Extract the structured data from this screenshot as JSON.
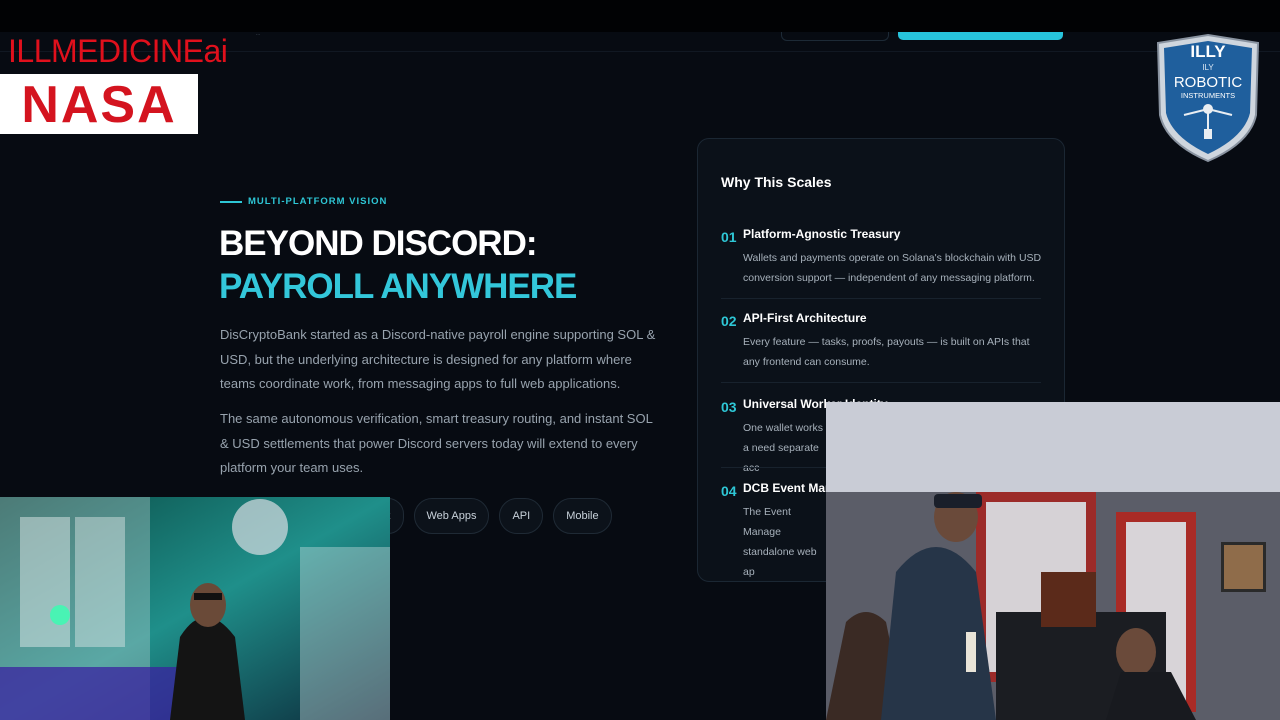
{
  "nav": {
    "tiny_text": "..."
  },
  "overlay": {
    "brand_text": "ILLMEDICINEai",
    "nasa_text": "NASA",
    "badge_lines": [
      "ILLY",
      "ILY",
      "ROBOTIC",
      "INSTRUMENTS"
    ]
  },
  "section": {
    "eyebrow": "MULTI-PLATFORM VISION",
    "headline_line1": "BEYOND DISCORD:",
    "headline_line2": "PAYROLL ANYWHERE",
    "paragraph1": "DisCryptoBank started as a Discord-native payroll engine supporting SOL & USD, but the underlying architecture is designed for any platform where teams coordinate work, from messaging apps to full web applications.",
    "paragraph2": "The same autonomous verification, smart treasury routing, and instant SOL & USD settlements that power Discord servers today will extend to every platform your team uses.",
    "chips": [
      "k",
      "Web Apps",
      "API",
      "Mobile"
    ]
  },
  "card": {
    "title": "Why This Scales",
    "items": [
      {
        "num": "01",
        "title": "Platform-Agnostic Treasury",
        "desc": "Wallets and payments operate on Solana's blockchain with USD conversion support — independent of any messaging platform."
      },
      {
        "num": "02",
        "title": "API-First Architecture",
        "desc": "Every feature — tasks, proofs, payouts — is built on APIs that any frontend can consume."
      },
      {
        "num": "03",
        "title": "Universal Worker Identity",
        "desc": "One wallet works a need separate acc"
      },
      {
        "num": "04",
        "title": "DCB Event Mana",
        "desc": "The Event Manage standalone web ap"
      }
    ]
  },
  "colors": {
    "accent": "#2ec7d6",
    "background": "#070b12",
    "card": "#0b1119",
    "brand_red": "#e0101c"
  }
}
